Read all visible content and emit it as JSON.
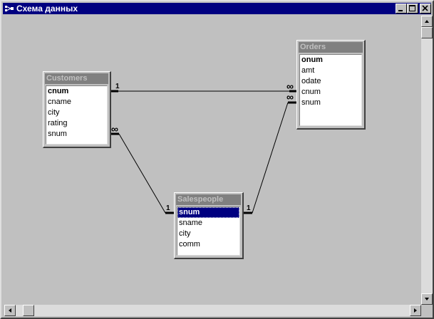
{
  "window": {
    "title": "Схема данных",
    "icon": "relationships-icon",
    "controls": [
      "minimize-icon",
      "maximize-icon",
      "close-icon"
    ]
  },
  "tables": {
    "customers": {
      "title": "Customers",
      "fields": [
        "cnum",
        "cname",
        "city",
        "rating",
        "snum"
      ],
      "key_field": "cnum"
    },
    "orders": {
      "title": "Orders",
      "fields": [
        "onum",
        "amt",
        "odate",
        "cnum",
        "snum"
      ],
      "key_field": "onum"
    },
    "salespeople": {
      "title": "Salespeople",
      "fields": [
        "snum",
        "sname",
        "city",
        "comm"
      ],
      "key_field": "snum",
      "selected_field": "snum"
    }
  },
  "relationships": [
    {
      "from": "Customers.cnum",
      "to": "Orders.cnum",
      "one_label": "1",
      "many_label": "∞"
    },
    {
      "from": "Salespeople.snum",
      "to": "Customers.snum",
      "one_label": "1",
      "many_label": "∞"
    },
    {
      "from": "Salespeople.snum",
      "to": "Orders.snum",
      "one_label": "1",
      "many_label": "∞"
    }
  ],
  "colors": {
    "titlebar": "#000080",
    "inactive_table_title": "#808080",
    "selection": "#000080",
    "background": "#c0c0c0"
  }
}
